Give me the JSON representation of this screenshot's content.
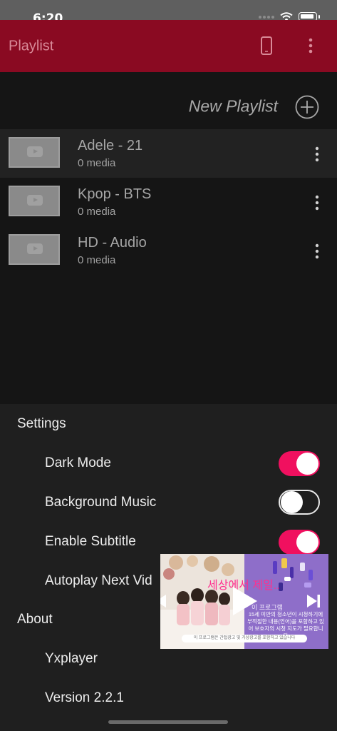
{
  "status_bar": {
    "time": "6:20"
  },
  "header": {
    "title": "Playlist"
  },
  "new_playlist": {
    "label": "New Playlist"
  },
  "playlists": [
    {
      "title": "Adele - 21",
      "count": "0 media"
    },
    {
      "title": "Kpop - BTS",
      "count": "0 media"
    },
    {
      "title": "HD - Audio",
      "count": "0 media"
    }
  ],
  "settings": {
    "header": "Settings",
    "items": [
      {
        "label": "Dark Mode",
        "enabled": true
      },
      {
        "label": "Background Music",
        "enabled": false
      },
      {
        "label": "Enable Subtitle",
        "enabled": true
      },
      {
        "label": "Autoplay Next Vid",
        "enabled": null
      }
    ]
  },
  "about": {
    "header": "About",
    "app_name": "Yxplayer",
    "version": "Version 2.2.1"
  },
  "ad": {
    "headline": "세상에서 제일..",
    "brand": "이 프로그램",
    "notice": "15세 미만의 청소년이 시청하기에 부적절한 내용(언어)을 포함하고 있어 보호자의 시청 지도가 필요합니다",
    "disclaimer": "이 프로그램은 간접광고 및 가상광고를 포함하고 있습니다"
  },
  "colors": {
    "accent": "#f0105f",
    "header_bg": "#8a0a22",
    "header_text": "#d98a98",
    "ad_purple": "#8e6ec9"
  }
}
